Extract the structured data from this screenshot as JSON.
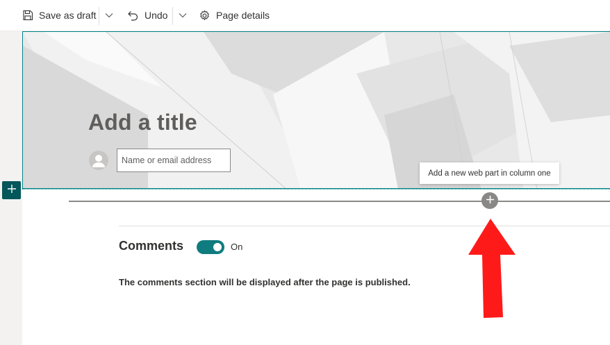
{
  "toolbar": {
    "save_draft_label": "Save as draft",
    "undo_label": "Undo",
    "page_details_label": "Page details"
  },
  "hero": {
    "title_placeholder": "Add a title",
    "author_placeholder": "Name or email address"
  },
  "webpart": {
    "tooltip": "Add a new web part in column one"
  },
  "comments": {
    "heading": "Comments",
    "toggle_state": "On",
    "toggle_on": true,
    "message": "The comments section will be displayed after the page is published."
  },
  "colors": {
    "accent": "#038387",
    "toggle": "#0f7c7f",
    "add_section": "#03565a",
    "annotation_arrow": "#ff1a1a"
  }
}
